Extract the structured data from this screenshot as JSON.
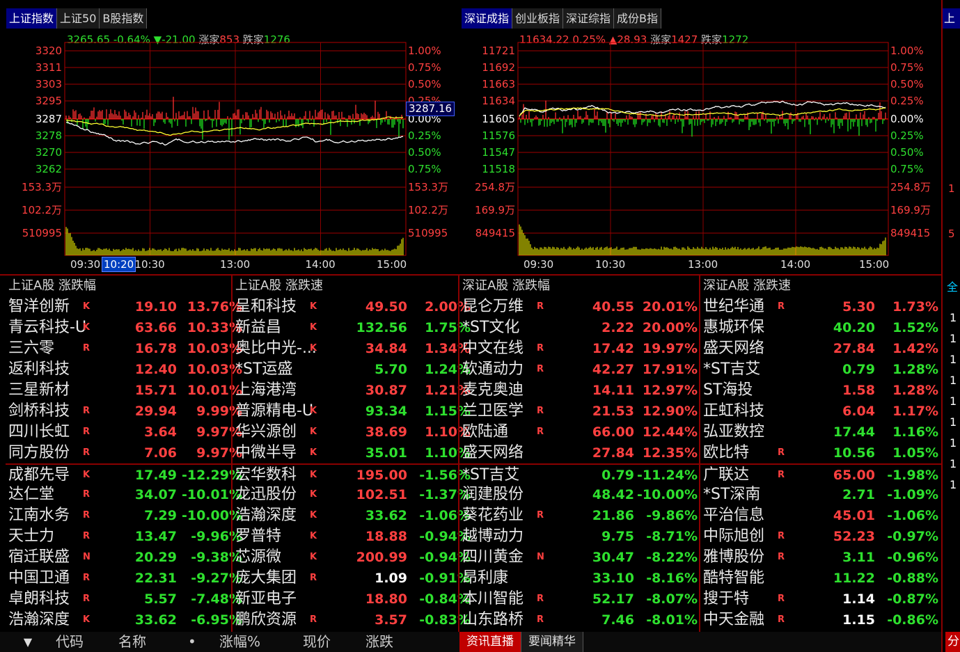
{
  "left_chart": {
    "tabs": [
      "上证指数",
      "上证50",
      "B股指数"
    ],
    "info": {
      "price": "3265.65",
      "pct": "-0.64%",
      "change": "▼-21.00",
      "up_label": "涨家",
      "up": "853",
      "down_label": "跌家",
      "down": "1276"
    },
    "price_labels": [
      "3320",
      "3311",
      "3303",
      "3295",
      "3287",
      "3278",
      "3270",
      "3262"
    ],
    "pct_labels": [
      "1.00%",
      "0.75%",
      "0.50%",
      "0.25%",
      "0.00%",
      "0.25%",
      "0.50%",
      "0.75%"
    ],
    "vol_labels": [
      "153.3万",
      "102.2万",
      "510995"
    ],
    "current_marker": "3287.16",
    "time_labels": [
      "09:30",
      "10:30",
      "13:00",
      "14:00",
      "15:00"
    ],
    "time_highlight": "10:20"
  },
  "right_chart": {
    "tabs": [
      "深证成指",
      "创业板指",
      "深证综指",
      "成份B指"
    ],
    "info": {
      "price": "11634.22",
      "pct": "0.25%",
      "change": "▲28.93",
      "up_label": "涨家",
      "up": "1427",
      "down_label": "跌家",
      "down": "1272"
    },
    "price_labels": [
      "11721",
      "11692",
      "11663",
      "11634",
      "11605",
      "11576",
      "11547",
      "11518"
    ],
    "pct_labels": [
      "1.00%",
      "0.75%",
      "0.50%",
      "0.25%",
      "0.00%",
      "0.25%",
      "0.50%",
      "0.75%"
    ],
    "vol_labels": [
      "254.8万",
      "169.9万",
      "849415"
    ],
    "time_labels": [
      "09:30",
      "10:30",
      "13:00",
      "14:00",
      "15:00"
    ]
  },
  "far_right": {
    "tab": "上",
    "labels": [
      "1",
      "5"
    ],
    "list_head": "全",
    "list_labels": [
      "1",
      "1",
      "1",
      "1",
      "1",
      "1",
      "1",
      "1",
      "1"
    ],
    "bottom_tab": "分"
  },
  "colors": {
    "up": "#ff4040",
    "down": "#2ee02e",
    "flat": "#ffffff",
    "grid": "#b00000",
    "volume": "#c8c800",
    "index_line": "#ffffff",
    "avg_line": "#ffff00"
  },
  "sections": [
    {
      "title": "上证A股  涨跌幅",
      "rows": [
        {
          "name": "智洋创新",
          "flag": "K",
          "price": "19.10",
          "pct": "13.76%",
          "dir": "up"
        },
        {
          "name": "青云科技-U",
          "flag": "K",
          "price": "63.66",
          "pct": "10.33%",
          "dir": "up"
        },
        {
          "name": "三六零",
          "flag": "R",
          "price": "16.78",
          "pct": "10.03%",
          "dir": "up"
        },
        {
          "name": "返利科技",
          "flag": "",
          "price": "12.40",
          "pct": "10.03%",
          "dir": "up"
        },
        {
          "name": "三星新材",
          "flag": "",
          "price": "15.71",
          "pct": "10.01%",
          "dir": "up"
        },
        {
          "name": "剑桥科技",
          "flag": "R",
          "price": "29.94",
          "pct": "9.99%",
          "dir": "up"
        },
        {
          "name": "四川长虹",
          "flag": "R",
          "price": "3.64",
          "pct": "9.97%",
          "dir": "up"
        },
        {
          "name": "同方股份",
          "flag": "R",
          "price": "7.06",
          "pct": "9.97%",
          "dir": "up"
        },
        {
          "name": "成都先导",
          "flag": "K",
          "price": "17.49",
          "pct": "-12.29%",
          "dir": "down"
        },
        {
          "name": "达仁堂",
          "flag": "R",
          "price": "34.07",
          "pct": "-10.01%",
          "dir": "down"
        },
        {
          "name": "江南水务",
          "flag": "R",
          "price": "7.29",
          "pct": "-10.00%",
          "dir": "down"
        },
        {
          "name": "天士力",
          "flag": "R",
          "price": "13.47",
          "pct": "-9.96%",
          "dir": "down"
        },
        {
          "name": "宿迁联盛",
          "flag": "N",
          "price": "20.29",
          "pct": "-9.38%",
          "dir": "down"
        },
        {
          "name": "中国卫通",
          "flag": "R",
          "price": "22.31",
          "pct": "-9.27%",
          "dir": "down"
        },
        {
          "name": "卓朗科技",
          "flag": "R",
          "price": "5.57",
          "pct": "-7.48%",
          "dir": "down"
        },
        {
          "name": "浩瀚深度",
          "flag": "K",
          "price": "33.62",
          "pct": "-6.95%",
          "dir": "down"
        }
      ]
    },
    {
      "title": "上证A股  涨跌速",
      "rows": [
        {
          "name": "呈和科技",
          "flag": "K",
          "price": "49.50",
          "pct": "2.00%",
          "dir": "up"
        },
        {
          "name": "新益昌",
          "flag": "K",
          "price": "132.56",
          "pct": "1.75%",
          "dir": "down",
          "pdir": "down"
        },
        {
          "name": "奥比中光-...",
          "flag": "K",
          "price": "34.84",
          "pct": "1.34%",
          "dir": "up"
        },
        {
          "name": "*ST运盛",
          "flag": "",
          "price": "5.70",
          "pct": "1.24%",
          "dir": "down",
          "pdir": "down"
        },
        {
          "name": "上海港湾",
          "flag": "",
          "price": "30.87",
          "pct": "1.21%",
          "dir": "up"
        },
        {
          "name": "普源精电-U",
          "flag": "K",
          "price": "93.34",
          "pct": "1.15%",
          "dir": "down",
          "pdir": "down"
        },
        {
          "name": "华兴源创",
          "flag": "K",
          "price": "38.69",
          "pct": "1.10%",
          "dir": "up"
        },
        {
          "name": "中微半导",
          "flag": "K",
          "price": "35.01",
          "pct": "1.10%",
          "dir": "down",
          "pdir": "down"
        },
        {
          "name": "宏华数科",
          "flag": "K",
          "price": "195.00",
          "pct": "-1.56%",
          "dir": "down",
          "pdir": "up"
        },
        {
          "name": "龙迅股份",
          "flag": "K",
          "price": "102.51",
          "pct": "-1.37%",
          "dir": "down",
          "pdir": "up"
        },
        {
          "name": "浩瀚深度",
          "flag": "K",
          "price": "33.62",
          "pct": "-1.06%",
          "dir": "down"
        },
        {
          "name": "罗普特",
          "flag": "K",
          "price": "18.88",
          "pct": "-0.94%",
          "dir": "down",
          "pdir": "up"
        },
        {
          "name": "芯源微",
          "flag": "K",
          "price": "200.99",
          "pct": "-0.94%",
          "dir": "down",
          "pdir": "up"
        },
        {
          "name": "庞大集团",
          "flag": "R",
          "price": "1.09",
          "pct": "-0.91%",
          "dir": "down",
          "pdir": "flat"
        },
        {
          "name": "新亚电子",
          "flag": "",
          "price": "18.80",
          "pct": "-0.84%",
          "dir": "down",
          "pdir": "up"
        },
        {
          "name": "鹏欣资源",
          "flag": "R",
          "price": "3.57",
          "pct": "-0.83%",
          "dir": "down",
          "pdir": "up"
        }
      ]
    },
    {
      "title": "深证A股  涨跌幅",
      "rows": [
        {
          "name": "昆仑万维",
          "flag": "R",
          "price": "40.55",
          "pct": "20.01%",
          "dir": "up"
        },
        {
          "name": "*ST文化",
          "flag": "",
          "price": "2.22",
          "pct": "20.00%",
          "dir": "up"
        },
        {
          "name": "中文在线",
          "flag": "R",
          "price": "17.42",
          "pct": "19.97%",
          "dir": "up"
        },
        {
          "name": "软通动力",
          "flag": "R",
          "price": "42.27",
          "pct": "17.91%",
          "dir": "up"
        },
        {
          "name": "麦克奥迪",
          "flag": "",
          "price": "14.11",
          "pct": "12.97%",
          "dir": "up"
        },
        {
          "name": "兰卫医学",
          "flag": "R",
          "price": "21.53",
          "pct": "12.90%",
          "dir": "up"
        },
        {
          "name": "欧陆通",
          "flag": "R",
          "price": "66.00",
          "pct": "12.44%",
          "dir": "up"
        },
        {
          "name": "盛天网络",
          "flag": "",
          "price": "27.84",
          "pct": "12.35%",
          "dir": "up"
        },
        {
          "name": "*ST吉艾",
          "flag": "",
          "price": "0.79",
          "pct": "-11.24%",
          "dir": "down"
        },
        {
          "name": "润建股份",
          "flag": "",
          "price": "48.42",
          "pct": "-10.00%",
          "dir": "down"
        },
        {
          "name": "葵花药业",
          "flag": "R",
          "price": "21.86",
          "pct": "-9.86%",
          "dir": "down"
        },
        {
          "name": "越博动力",
          "flag": "",
          "price": "9.75",
          "pct": "-8.71%",
          "dir": "down"
        },
        {
          "name": "四川黄金",
          "flag": "N",
          "price": "30.47",
          "pct": "-8.22%",
          "dir": "down"
        },
        {
          "name": "昂利康",
          "flag": "",
          "price": "33.10",
          "pct": "-8.16%",
          "dir": "down"
        },
        {
          "name": "本川智能",
          "flag": "R",
          "price": "52.17",
          "pct": "-8.07%",
          "dir": "down"
        },
        {
          "name": "山东路桥",
          "flag": "R",
          "price": "7.46",
          "pct": "-8.01%",
          "dir": "down"
        }
      ]
    },
    {
      "title": "深证A股  涨跌速",
      "rows": [
        {
          "name": "世纪华通",
          "flag": "R",
          "price": "5.30",
          "pct": "1.73%",
          "dir": "up"
        },
        {
          "name": "惠城环保",
          "flag": "",
          "price": "40.20",
          "pct": "1.52%",
          "dir": "down",
          "pdir": "down"
        },
        {
          "name": "盛天网络",
          "flag": "",
          "price": "27.84",
          "pct": "1.42%",
          "dir": "up"
        },
        {
          "name": "*ST吉艾",
          "flag": "",
          "price": "0.79",
          "pct": "1.28%",
          "dir": "down",
          "pdir": "down"
        },
        {
          "name": "ST海投",
          "flag": "",
          "price": "1.58",
          "pct": "1.28%",
          "dir": "up"
        },
        {
          "name": "正虹科技",
          "flag": "",
          "price": "6.04",
          "pct": "1.17%",
          "dir": "up"
        },
        {
          "name": "弘亚数控",
          "flag": "",
          "price": "17.44",
          "pct": "1.16%",
          "dir": "down",
          "pdir": "down"
        },
        {
          "name": "欧比特",
          "flag": "R",
          "price": "10.56",
          "pct": "1.05%",
          "dir": "down",
          "pdir": "down"
        },
        {
          "name": "广联达",
          "flag": "R",
          "price": "65.00",
          "pct": "-1.98%",
          "dir": "down",
          "pdir": "up"
        },
        {
          "name": "*ST深南",
          "flag": "",
          "price": "2.71",
          "pct": "-1.09%",
          "dir": "down"
        },
        {
          "name": "平治信息",
          "flag": "",
          "price": "45.01",
          "pct": "-1.06%",
          "dir": "down",
          "pdir": "up"
        },
        {
          "name": "中际旭创",
          "flag": "R",
          "price": "52.23",
          "pct": "-0.97%",
          "dir": "down",
          "pdir": "up"
        },
        {
          "name": "雅博股份",
          "flag": "R",
          "price": "3.11",
          "pct": "-0.96%",
          "dir": "down"
        },
        {
          "name": "酷特智能",
          "flag": "",
          "price": "11.22",
          "pct": "-0.88%",
          "dir": "down"
        },
        {
          "name": "搜于特",
          "flag": "R",
          "price": "1.14",
          "pct": "-0.87%",
          "dir": "down",
          "pdir": "flat"
        },
        {
          "name": "中天金融",
          "flag": "R",
          "price": "1.15",
          "pct": "-0.86%",
          "dir": "down",
          "pdir": "flat"
        }
      ]
    }
  ],
  "bottom_bar": {
    "items": [
      "▼",
      "代码",
      "名称",
      "•",
      "涨幅%",
      "现价",
      "涨跌"
    ],
    "news_tabs": [
      "资讯直播",
      "要闻精华"
    ]
  }
}
